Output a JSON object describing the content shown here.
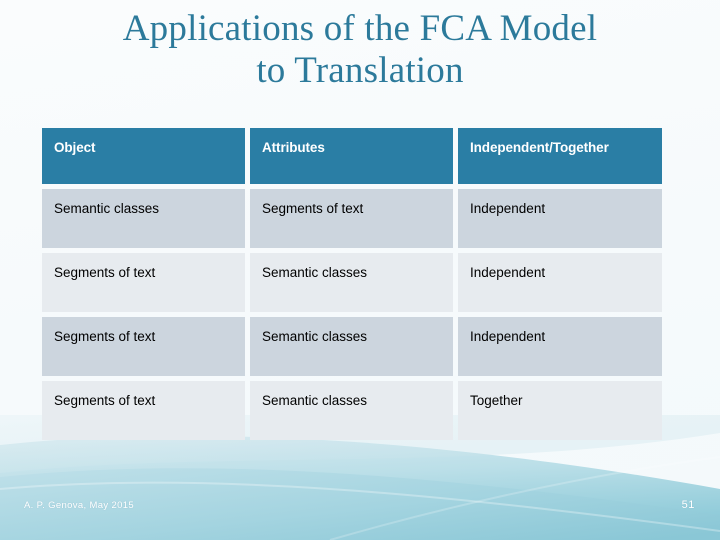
{
  "slide": {
    "title": "Applications of the FCA Model\nto Translation",
    "background_color": "#f7fafc",
    "accent_color": "#2a7ea5",
    "title_color": "#2c7a9b"
  },
  "table": {
    "headers": [
      "Object",
      "Attributes",
      "Independent/Together"
    ],
    "rows": [
      {
        "object": "Semantic classes",
        "attributes": "Segments of text",
        "relation": "Independent"
      },
      {
        "object": "Segments of text",
        "attributes": "Semantic classes",
        "relation": "Independent"
      },
      {
        "object": "Segments of text",
        "attributes": "Semantic classes",
        "relation": "Independent"
      },
      {
        "object": "Segments of text",
        "attributes": "Semantic classes",
        "relation": "Together"
      }
    ],
    "header_bg": "#2a7ea5",
    "band_dark_bg": "#ccd5de",
    "band_light_bg": "#e7ebef"
  },
  "footer": {
    "author": "A. P. Genova, May 2015",
    "page_number": "51"
  }
}
